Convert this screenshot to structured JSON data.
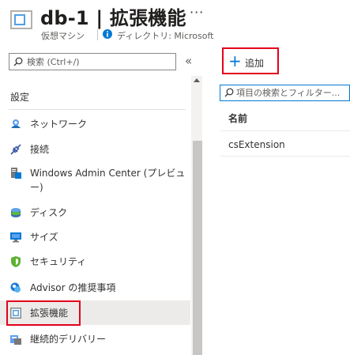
{
  "header": {
    "title": "db-1 | 拡張機能",
    "more": "···",
    "subtitle": "仮想マシン",
    "directory": "ディレクトリ: Microsoft"
  },
  "sidebar": {
    "search_placeholder": "検索 (Ctrl+/)",
    "collapse": "«",
    "section": "設定",
    "items": [
      {
        "label": "ネットワーク",
        "icon": "network-icon"
      },
      {
        "label": "接続",
        "icon": "connect-icon"
      },
      {
        "label": "Windows Admin Center (プレビュー)",
        "label_line1": "Windows Admin Center (プレビュ",
        "label_line2": "ー)",
        "icon": "admin-center-icon"
      },
      {
        "label": "ディスク",
        "icon": "disk-icon"
      },
      {
        "label": "サイズ",
        "icon": "size-icon"
      },
      {
        "label": "セキュリティ",
        "icon": "security-icon"
      },
      {
        "label": "Advisor の推奨事項",
        "icon": "advisor-icon"
      },
      {
        "label": "拡張機能",
        "icon": "extensions-icon",
        "active": true
      },
      {
        "label": "継続的デリバリー",
        "icon": "continuous-delivery-icon"
      }
    ]
  },
  "main": {
    "add_label": "追加",
    "filter_placeholder": "項目の検索とフィルター...",
    "column_header": "名前",
    "rows": [
      {
        "name": "csExtension"
      }
    ]
  },
  "colors": {
    "accent": "#0078d4",
    "highlight": "#e3001b",
    "active_bg": "#edebe9"
  }
}
